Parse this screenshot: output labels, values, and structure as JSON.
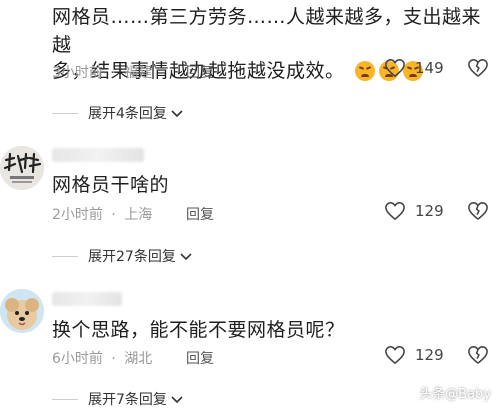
{
  "comments": [
    {
      "text_line1": "网格员……第三方劳务……人越来越多，支出越来越",
      "text_line2": "多，结果事情越办越拖越没成效。",
      "time": "3小时前",
      "location": "福建",
      "reply_label": "回复",
      "likes": "149",
      "expand_label": "展开4条回复"
    },
    {
      "text_line1": "网格员干啥的",
      "time": "2小时前",
      "location": "上海",
      "reply_label": "回复",
      "likes": "129",
      "expand_label": "展开27条回复"
    },
    {
      "text_line1": "换个思路，能不能不要网格员呢？",
      "time": "6小时前",
      "location": "湖北",
      "reply_label": "回复",
      "likes": "129",
      "expand_label": "展开7条回复"
    }
  ],
  "watermark": "头条@Baby",
  "icons": {
    "like": "heart-icon",
    "dislike": "broken-heart-icon",
    "expand": "chevron-down-icon",
    "emoji": "crying-face-emoji"
  },
  "colors": {
    "text": "#1f1f1f",
    "meta": "#9a9a9a",
    "emoji": "#f6b52b"
  }
}
